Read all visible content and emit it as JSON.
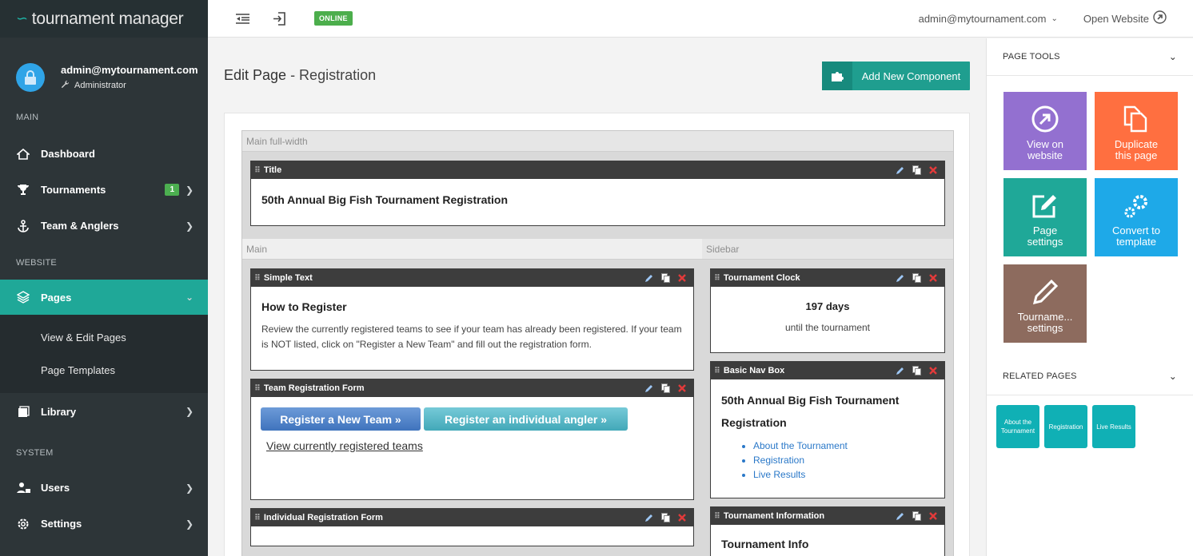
{
  "brand": {
    "name": "tournament manager"
  },
  "user": {
    "email": "admin@mytournament.com",
    "role": "Administrator"
  },
  "sidebar": {
    "sections": {
      "main": "MAIN",
      "website": "WEBSITE",
      "system": "SYSTEM"
    },
    "items": {
      "dashboard": "Dashboard",
      "tournaments": "Tournaments",
      "tournaments_badge": "1",
      "teams": "Team & Anglers",
      "pages": "Pages",
      "view_edit": "View & Edit Pages",
      "templates": "Page Templates",
      "library": "Library",
      "users": "Users",
      "settings": "Settings"
    }
  },
  "topbar": {
    "status": "ONLINE",
    "account": "admin@mytournament.com",
    "open_website": "Open Website"
  },
  "page": {
    "title": "Edit Page",
    "subtitle": " - Registration",
    "add_button": "Add New Component"
  },
  "zones": {
    "full": "Main full-width",
    "main": "Main",
    "sidebar": "Sidebar"
  },
  "components": {
    "title": {
      "header": "Title",
      "text": "50th Annual Big Fish Tournament Registration"
    },
    "simple_text": {
      "header": "Simple Text",
      "heading": "How to Register",
      "body": "Review the currently registered teams to see if your team has already been registered. If your team is NOT listed, click on \"Register a New Team\" and fill out the registration form."
    },
    "team_form": {
      "header": "Team Registration Form",
      "btn_team": "Register a New Team »",
      "btn_angler": "Register an individual angler »",
      "link": "View currently registered teams"
    },
    "individual_form": {
      "header": "Individual Registration Form"
    },
    "clock": {
      "header": "Tournament Clock",
      "days": "197 days",
      "caption": "until the tournament"
    },
    "nav_box": {
      "header": "Basic Nav Box",
      "title": "50th Annual Big Fish Tournament Registration",
      "links": [
        "About the Tournament",
        "Registration",
        "Live Results"
      ]
    },
    "info": {
      "header": "Tournament Information",
      "heading": "Tournament Info"
    }
  },
  "right_panel": {
    "tools_title": "PAGE TOOLS",
    "tiles": {
      "view": "View on website",
      "duplicate": "Duplicate this page",
      "settings": "Page settings",
      "convert": "Convert to template",
      "tournament": "Tourname... settings"
    },
    "related_title": "RELATED PAGES",
    "related": [
      "About the Tournament",
      "Registration",
      "Live Results"
    ]
  },
  "colors": {
    "accent": "#1fa898",
    "sidebar": "#2d3538",
    "purple": "#9370d0",
    "orange": "#ff6f40",
    "teal": "#1fa898",
    "blue": "#1ea9e8",
    "brown": "#8d6b5e",
    "related": "#10b0b5"
  }
}
